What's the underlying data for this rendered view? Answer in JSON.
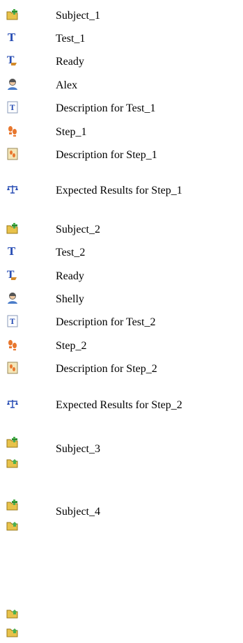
{
  "tree": {
    "group1": {
      "subject": {
        "label": "Subject_1",
        "icon": "new-folder-icon"
      },
      "test": {
        "label": "Test_1",
        "icon": "test-icon"
      },
      "status": {
        "label": "Ready",
        "icon": "status-icon"
      },
      "owner": {
        "label": "Alex",
        "icon": "user-icon"
      },
      "test_desc": {
        "label": "Description for Test_1",
        "icon": "description-icon"
      },
      "step": {
        "label": "Step_1",
        "icon": "step-icon"
      },
      "step_desc": {
        "label": "Description for Step_1",
        "icon": "step-description-icon"
      },
      "expected": {
        "label": "Expected Results for Step_1",
        "icon": "scales-icon"
      }
    },
    "group2": {
      "subject": {
        "label": "Subject_2",
        "icon": "new-folder-icon"
      },
      "test": {
        "label": "Test_2",
        "icon": "test-icon"
      },
      "status": {
        "label": "Ready",
        "icon": "status-icon"
      },
      "owner": {
        "label": "Shelly",
        "icon": "user-icon"
      },
      "test_desc": {
        "label": "Description for Test_2",
        "icon": "description-icon"
      },
      "step": {
        "label": "Step_2",
        "icon": "step-icon"
      },
      "step_desc": {
        "label": "Description for Step_2",
        "icon": "step-description-icon"
      },
      "expected": {
        "label": "Expected Results for Step_2",
        "icon": "scales-icon"
      }
    },
    "group3": {
      "subject": {
        "label": "Subject_3",
        "icon": "new-folder-icon"
      },
      "folder_icon": "folder-up-icon"
    },
    "group4": {
      "subject": {
        "label": "Subject_4",
        "icon": "new-folder-icon"
      },
      "folder_icon": "folder-up-icon"
    },
    "trailing_folder_icons": [
      "folder-up-icon",
      "folder-up-icon"
    ]
  }
}
